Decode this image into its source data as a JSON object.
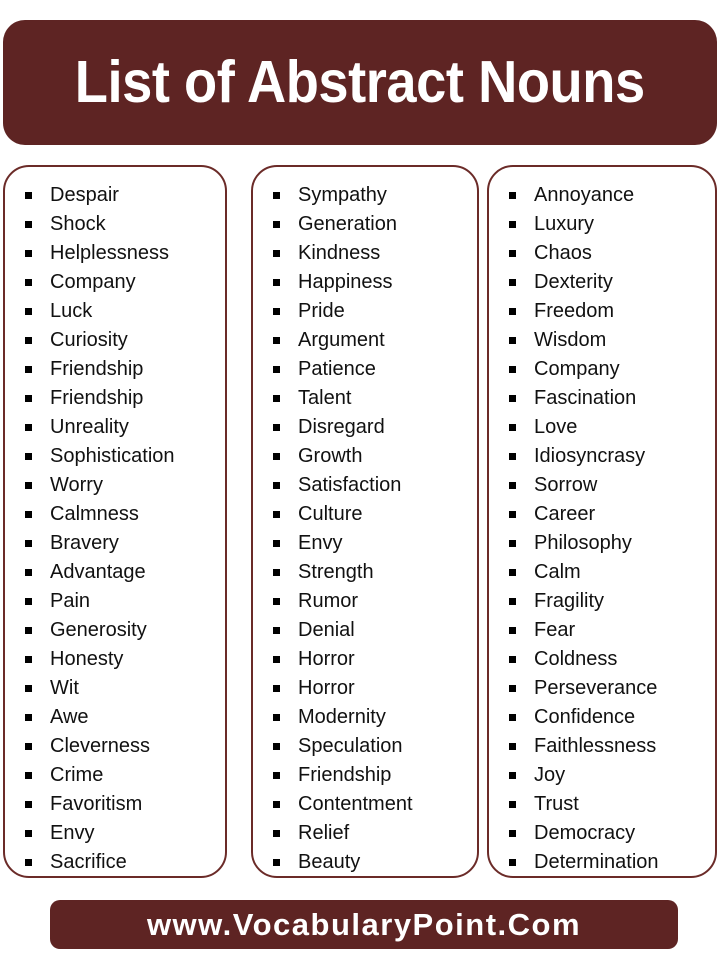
{
  "header": {
    "title": "List of Abstract Nouns",
    "background_color": "#5E2423",
    "text_color": "#FFFFFF"
  },
  "theme": {
    "accent_color": "#5E2423",
    "card_border_color": "#6B2B28",
    "page_background": "#FFFFFF",
    "bullet_color": "#000000",
    "word_text_color": "#111111"
  },
  "columns": [
    {
      "id": "column-1",
      "items": [
        "Despair",
        "Shock",
        "Helplessness",
        "Company",
        "Luck",
        "Curiosity",
        "Friendship",
        "Friendship",
        "Unreality",
        "Sophistication",
        "Worry",
        "Calmness",
        "Bravery",
        "Advantage",
        "Pain",
        "Generosity",
        "Honesty",
        "Wit",
        "Awe",
        "Cleverness",
        "Crime",
        "Favoritism",
        "Envy",
        "Sacrifice"
      ]
    },
    {
      "id": "column-2",
      "items": [
        "Sympathy",
        "Generation",
        "Kindness",
        "Happiness",
        "Pride",
        "Argument",
        "Patience",
        "Talent",
        "Disregard",
        "Growth",
        "Satisfaction",
        "Culture",
        "Envy",
        "Strength",
        "Rumor",
        "Denial",
        "Horror",
        "Horror",
        "Modernity",
        "Speculation",
        "Friendship",
        "Contentment",
        "Relief",
        "Beauty"
      ]
    },
    {
      "id": "column-3",
      "items": [
        "Annoyance",
        "Luxury",
        "Chaos",
        "Dexterity",
        "Freedom",
        "Wisdom",
        "Company",
        "Fascination",
        "Love",
        "Idiosyncrasy",
        "Sorrow",
        "Career",
        "Philosophy",
        "Calm",
        "Fragility",
        "Fear",
        "Coldness",
        "Perseverance",
        "Confidence",
        "Faithlessness",
        "Joy",
        "Trust",
        "Democracy",
        "Determination"
      ]
    }
  ],
  "footer": {
    "website": "www.VocabularyPoint.Com",
    "background_color": "#5E2423",
    "text_color": "#FFFFFF"
  }
}
